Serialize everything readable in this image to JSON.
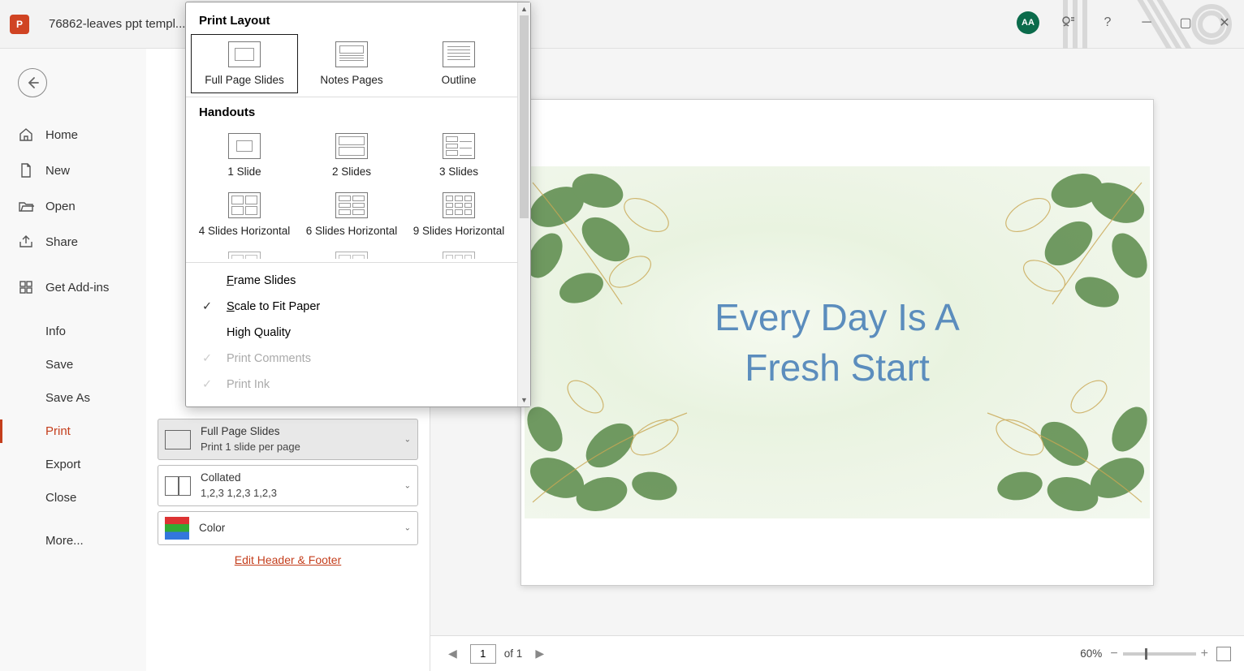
{
  "titlebar": {
    "filename": "76862-leaves ppt templ...",
    "avatar": "AA"
  },
  "backstage": {
    "back": "←",
    "items": [
      {
        "label": "Home",
        "icon": "home"
      },
      {
        "label": "New",
        "icon": "file"
      },
      {
        "label": "Open",
        "icon": "folder"
      },
      {
        "label": "Share",
        "icon": "share"
      },
      {
        "label": "Get Add-ins",
        "icon": "grid"
      },
      {
        "label": "Info"
      },
      {
        "label": "Save"
      },
      {
        "label": "Save As"
      },
      {
        "label": "Print",
        "active": true
      },
      {
        "label": "Export"
      },
      {
        "label": "Close"
      },
      {
        "label": "More..."
      }
    ]
  },
  "print_panel": {
    "layout": {
      "title": "Full Page Slides",
      "sub": "Print 1 slide per page"
    },
    "collate": {
      "title": "Collated",
      "sub": "1,2,3    1,2,3    1,2,3"
    },
    "color": {
      "title": "Color"
    },
    "footer_link": "Edit Header & Footer"
  },
  "popup": {
    "section_layout": "Print Layout",
    "layout_options": [
      {
        "label": "Full Page Slides",
        "selected": true
      },
      {
        "label": "Notes Pages"
      },
      {
        "label": "Outline"
      }
    ],
    "section_handouts": "Handouts",
    "handouts": [
      {
        "label": "1 Slide",
        "grid": "1x1"
      },
      {
        "label": "2 Slides",
        "grid": "2x1"
      },
      {
        "label": "3 Slides",
        "grid": "3x1n"
      },
      {
        "label": "4 Slides Horizontal",
        "grid": "2x2"
      },
      {
        "label": "6 Slides Horizontal",
        "grid": "3x2"
      },
      {
        "label": "9 Slides Horizontal",
        "grid": "3x3"
      }
    ],
    "checks": [
      {
        "label": "Frame Slides",
        "hot": "F",
        "checked": false
      },
      {
        "label": "Scale to Fit Paper",
        "hot": "S",
        "checked": true
      },
      {
        "label": "High Quality",
        "checked": false
      },
      {
        "label": "Print Comments",
        "checked": true,
        "disabled": true
      },
      {
        "label": "Print Ink",
        "checked": true,
        "disabled": true
      }
    ]
  },
  "preview": {
    "slide_title_line1": "Every Day Is A",
    "slide_title_line2": "Fresh Start"
  },
  "statusbar": {
    "page_current": "1",
    "page_of": "of 1",
    "zoom": "60%"
  }
}
